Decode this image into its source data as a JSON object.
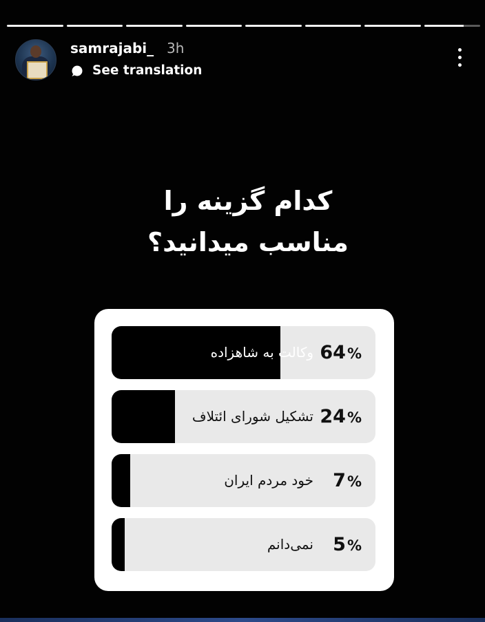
{
  "story": {
    "segments_total": 8,
    "segment_current": 8,
    "segment_current_progress": 0.7
  },
  "header": {
    "username": "samrajabi_",
    "time": "3h",
    "translate_label": "See translation"
  },
  "poll": {
    "question_line1": "کدام گزینه را",
    "question_line2": "مناسب میدانید؟",
    "options": [
      {
        "label": "وکالت به شاهزاده",
        "percent": 64,
        "percent_text": "64"
      },
      {
        "label": "تشکیل شورای ائتلاف",
        "percent": 24,
        "percent_text": "24"
      },
      {
        "label": "خود مردم ایران",
        "percent": 7,
        "percent_text": "7"
      },
      {
        "label": "نمی‌دانم",
        "percent": 5,
        "percent_text": "5"
      }
    ],
    "percent_sign": "%"
  },
  "colors": {
    "background": "#020202",
    "card": "#ffffff",
    "option_bg": "#e9e9e9",
    "option_fill": "#000000"
  }
}
